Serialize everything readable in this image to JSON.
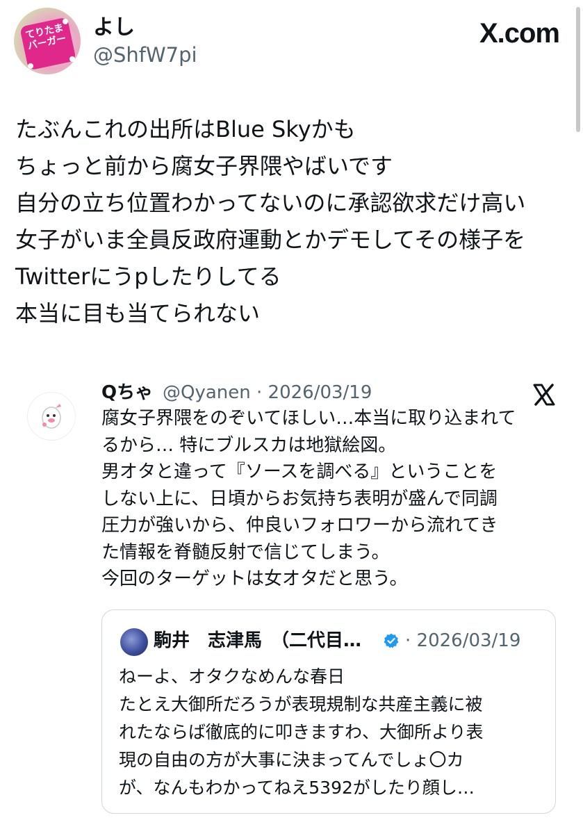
{
  "post": {
    "display_name": "よし",
    "handle": "@ShfW7pi",
    "site_label": "X.com",
    "avatar_text": "てりたまバーガー",
    "lines": [
      "たぶんこれの出所はBlue Skyかも",
      "ちょっと前から腐女子界隈やばいです",
      "自分の立ち位置わかってないのに承認欲求だけ高い",
      "女子がいま全員反政府運動とかデモしてその様子を",
      "Twitterにうpしたりしてる",
      "本当に目も当てられない"
    ]
  },
  "quote": {
    "display_name": "Qちゃ",
    "handle_date": "@Qyanen · 2026/03/19",
    "lines": [
      "腐女子界隈をのぞいてほしい…本当に取り込まれて",
      "るから… 特にブルスカは地獄絵図。",
      "男オタと違って『ソースを調べる』ということを",
      "しない上に、日頃からお気持ち表明が盛んで同調",
      "圧力が強いから、仲良いフォロワーから流れてき",
      "た情報を脊髄反射で信じてしまう。",
      "今回のターゲットは女オタだと思う。"
    ],
    "nested": {
      "display_name": "駒井　志津馬　（二代目…",
      "date": "· 2026/03/19",
      "lines": [
        "ねーよ、オタクなめんな春日",
        "たとえ大御所だろうが表現規制な共産主義に被",
        "れたならば徹底的に叩きますわ、大御所より表",
        "現の自由の方が大事に決まってんでしょ〇カ",
        "が、なんもわかってねえ5392がしたり顔し…"
      ]
    }
  },
  "colors": {
    "text": "#0f1419",
    "secondary": "#536471",
    "verified": "#1d9bf0",
    "card_border": "#cfd9de"
  },
  "icons": {
    "x_logo": "x-logo-icon",
    "verified": "verified-badge-icon"
  }
}
